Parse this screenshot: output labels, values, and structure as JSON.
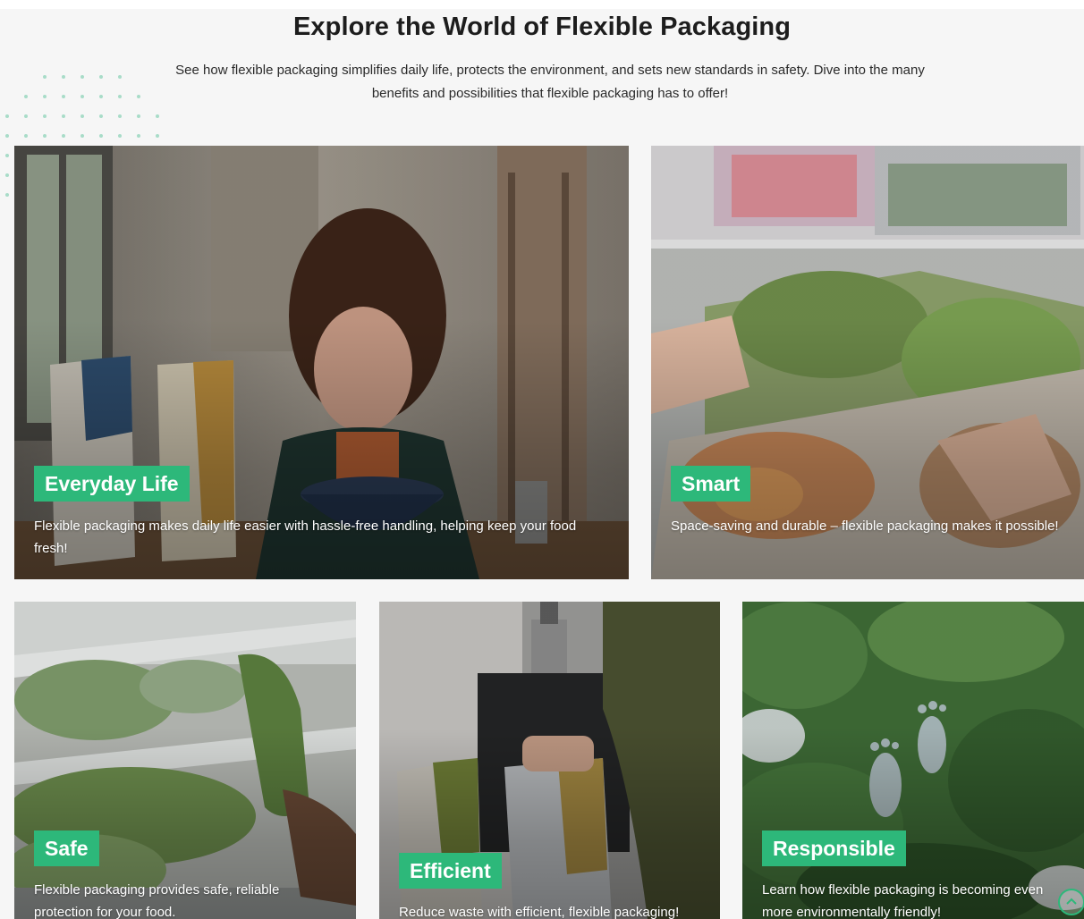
{
  "section": {
    "title": "Explore the World of Flexible Packaging",
    "subtitle": "See how flexible packaging simplifies daily life, protects the environment, and sets new standards in safety. Dive into the many benefits and possibilities that flexible packaging has to offer!"
  },
  "cards": [
    {
      "title": "Everyday Life",
      "text": "Flexible packaging makes daily life easier with hassle-free handling, helping keep your food fresh!"
    },
    {
      "title": "Smart",
      "text": "Space-saving and durable – flexible packaging makes it possible!"
    },
    {
      "title": "Safe",
      "text": "Flexible packaging provides safe, reliable protection for your food."
    },
    {
      "title": "Efficient",
      "text": "Reduce waste with efficient, flexible packaging!"
    },
    {
      "title": "Responsible",
      "text": "Learn how flexible packaging is becoming even more environmentally friendly!"
    }
  ],
  "icons": {
    "scroll_top": "chevron-up-icon"
  },
  "colors": {
    "accent": "#2db87a",
    "background": "#f6f6f6"
  }
}
